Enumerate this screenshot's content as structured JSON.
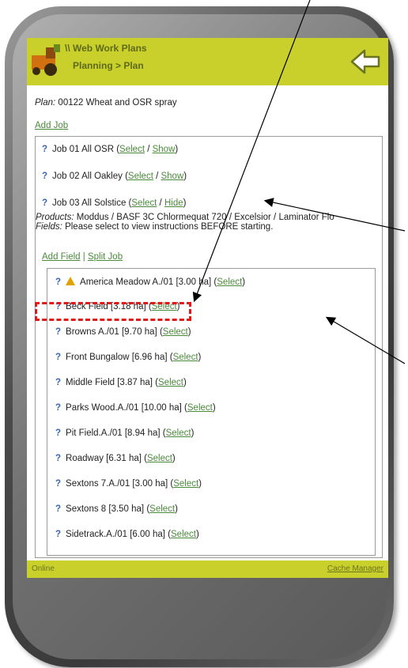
{
  "header": {
    "line1": "\\\\ Web Work Plans",
    "line2": "Planning > Plan"
  },
  "plan": {
    "label": "Plan:",
    "value": "00122 Wheat and OSR spray"
  },
  "add_job_label": "Add Job",
  "jobs": [
    {
      "name": "Job 01 All OSR (",
      "select": "Select",
      "sep": " / ",
      "action": "Show",
      "close": ")"
    },
    {
      "name": "Job 02 All Oakley (",
      "select": "Select",
      "sep": " / ",
      "action": "Show",
      "close": ")"
    },
    {
      "name": "Job 03 All Solstice (",
      "select": "Select",
      "sep": " / ",
      "action": "Hide",
      "close": ")"
    }
  ],
  "details": {
    "products_label": "Products:",
    "products_value": " Moddus / BASF 3C Chlormequat 720 / Excelsior / Laminator Flo",
    "fields_label": "Fields:",
    "fields_value": " Please select to view instructions BEFORE starting."
  },
  "job_actions": {
    "add_field": "Add Field",
    "sep": " | ",
    "split_job": "Split Job"
  },
  "fields": [
    {
      "name": "America Meadow A./01 [3.00 ha] (",
      "select": "Select",
      "close": ")",
      "warning": true
    },
    {
      "name": "Beck Field [3.18 ha] (",
      "select": "Select",
      "close": ")"
    },
    {
      "name": "Browns A./01 [9.70 ha] (",
      "select": "Select",
      "close": ")"
    },
    {
      "name": "Front Bungalow [6.96 ha] (",
      "select": "Select",
      "close": ")"
    },
    {
      "name": "Middle Field [3.87 ha] (",
      "select": "Select",
      "close": ")"
    },
    {
      "name": "Parks Wood.A./01 [10.00 ha] (",
      "select": "Select",
      "close": ")"
    },
    {
      "name": "Pit Field.A./01 [8.94 ha] (",
      "select": "Select",
      "close": ")"
    },
    {
      "name": "Roadway [6.31 ha] (",
      "select": "Select",
      "close": ")"
    },
    {
      "name": "Sextons 7.A./01 [3.00 ha] (",
      "select": "Select",
      "close": ")"
    },
    {
      "name": "Sextons 8 [3.50 ha] (",
      "select": "Select",
      "close": ")"
    },
    {
      "name": "Sidetrack.A./01 [6.00 ha] (",
      "select": "Select",
      "close": ")"
    }
  ],
  "footer": {
    "status": "Online",
    "cache_manager": "Cache Manager"
  },
  "colors": {
    "header_bg": "#c9d02c",
    "link": "#4a8a3a",
    "help_icon": "#3a63b6",
    "highlight": "#e01919"
  },
  "icons": {
    "logo": "tractor-logo-icon",
    "back": "back-arrow-icon",
    "help": "help-question-icon",
    "warning": "warning-icon"
  }
}
